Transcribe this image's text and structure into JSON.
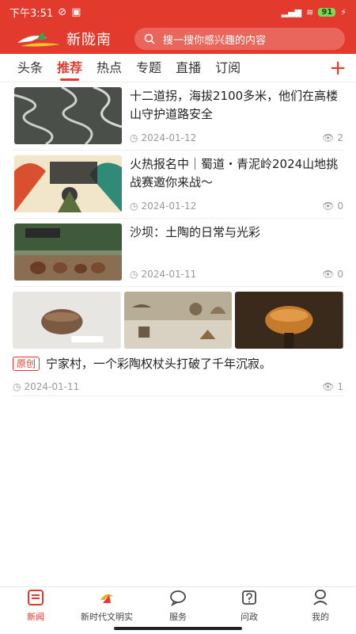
{
  "status_bar": {
    "time": "下午3:51",
    "battery": "91"
  },
  "header": {
    "logo_text": "新陇南",
    "search_placeholder": "搜一搜你感兴趣的内容"
  },
  "tabs": [
    {
      "label": "头条"
    },
    {
      "label": "推荐"
    },
    {
      "label": "热点"
    },
    {
      "label": "专题"
    },
    {
      "label": "直播"
    },
    {
      "label": "订阅"
    }
  ],
  "active_tab": "推荐",
  "news": [
    {
      "title": "十二道拐，海拔2100多米，他们在高楼山守护道路安全",
      "date": "2024-01-12",
      "views": "2"
    },
    {
      "title": "火热报名中｜蜀道・青泥岭2024山地挑战赛邀你来战～",
      "date": "2024-01-12",
      "views": "0"
    },
    {
      "title": "沙坝：土陶的日常与光彩",
      "date": "2024-01-11",
      "views": "0"
    }
  ],
  "multi_news": {
    "badge": "原创",
    "title": "宁家村，一个彩陶权杖头打破了千年沉寂。",
    "date": "2024-01-11",
    "views": "1"
  },
  "bottom_nav": [
    {
      "label": "新闻",
      "icon": "news-icon"
    },
    {
      "label": "新时代文明实",
      "icon": "civilization-icon"
    },
    {
      "label": "服务",
      "icon": "chat-icon"
    },
    {
      "label": "问政",
      "icon": "question-icon"
    },
    {
      "label": "我的",
      "icon": "profile-icon"
    }
  ],
  "colors": {
    "brand": "#e23b2e"
  }
}
